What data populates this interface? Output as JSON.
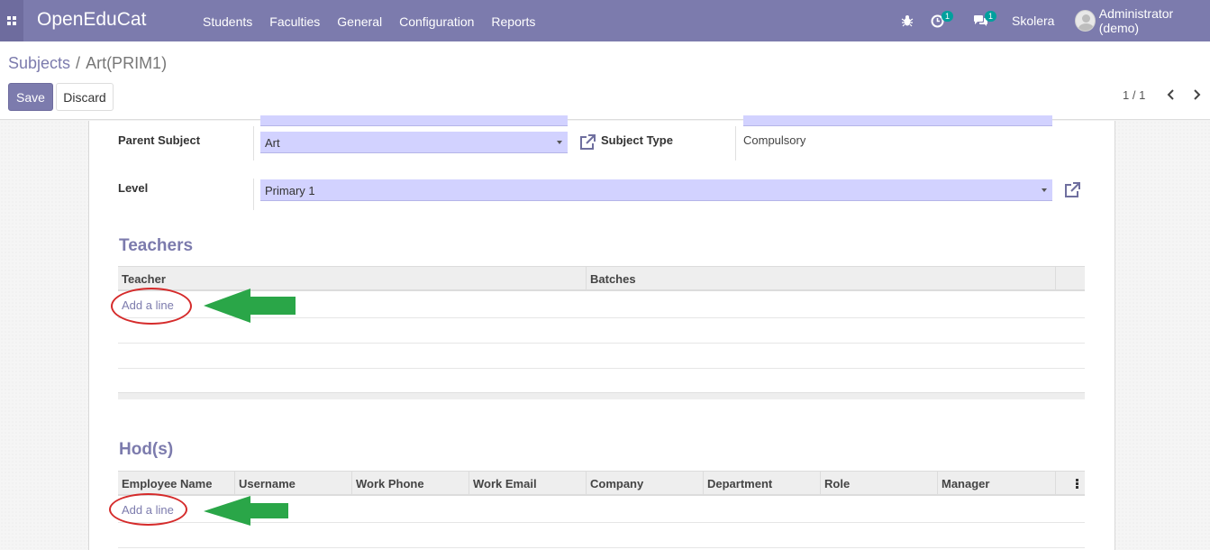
{
  "navbar": {
    "brand": "OpenEduCat",
    "menu": [
      "Students",
      "Faculties",
      "General",
      "Configuration",
      "Reports"
    ],
    "activity_count": "1",
    "messages_count": "1",
    "company": "Skolera",
    "user": "Administrator (demo)",
    "color": "#7c7bad"
  },
  "control": {
    "breadcrumb_root": "Subjects",
    "breadcrumb_sep": "/",
    "breadcrumb_current": "Art(PRIM1)",
    "save_label": "Save",
    "discard_label": "Discard",
    "pager": "1 / 1"
  },
  "form": {
    "parent_subject_label": "Parent Subject",
    "parent_subject_value": "Art",
    "subject_type_label": "Subject Type",
    "subject_type_value": "Compulsory",
    "level_label": "Level",
    "level_value": "Primary 1"
  },
  "teachers": {
    "title": "Teachers",
    "columns": [
      "Teacher",
      "Batches"
    ],
    "add_line": "Add a line"
  },
  "hods": {
    "title": "Hod(s)",
    "columns": [
      "Employee Name",
      "Username",
      "Work Phone",
      "Work Email",
      "Company",
      "Department",
      "Role",
      "Manager"
    ],
    "add_line": "Add a line"
  },
  "annotations": {
    "highlight_color": "#d52b2b",
    "arrow_color": "#2aa648"
  }
}
